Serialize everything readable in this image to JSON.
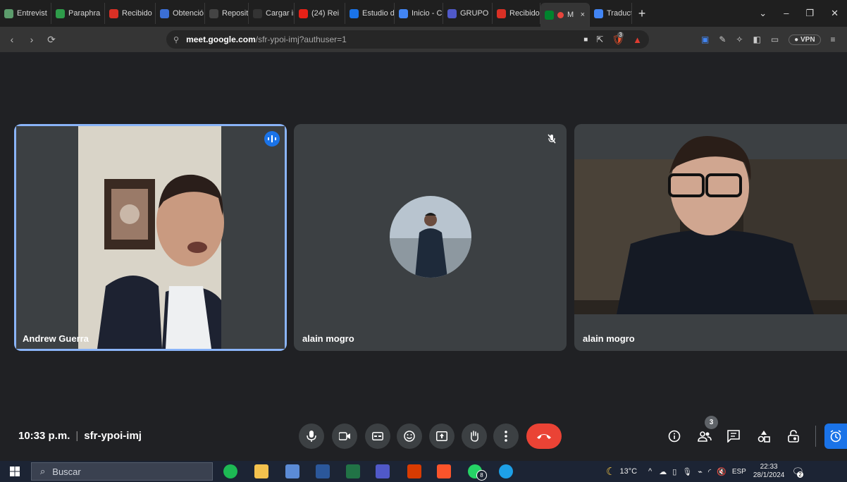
{
  "browser": {
    "tabs": [
      {
        "label": "Entrevist",
        "icon": "green-square-icon",
        "color": "#5c9c6c"
      },
      {
        "label": "Paraphra",
        "icon": "paraphrase-icon",
        "color": "#2e9c4a"
      },
      {
        "label": "Recibido",
        "icon": "gmail-icon",
        "color": "#d93025"
      },
      {
        "label": "Obtenció",
        "icon": "graduation-cap-icon",
        "color": "#3b6fd6"
      },
      {
        "label": "Reposito",
        "icon": "repository-icon",
        "color": "#444444"
      },
      {
        "label": "Cargar in",
        "icon": "c-icon",
        "color": "#333333"
      },
      {
        "label": "(24) Rei",
        "icon": "youtube-icon",
        "color": "#e62117"
      },
      {
        "label": "Estudio d",
        "icon": "s-icon",
        "color": "#1a73e8"
      },
      {
        "label": "Inicio - C",
        "icon": "circle-icon",
        "color": "#4285f4"
      },
      {
        "label": "GRUPO",
        "icon": "teams-icon",
        "color": "#5059c9"
      },
      {
        "label": "Recibido",
        "icon": "gmail-icon",
        "color": "#d93025"
      },
      {
        "label": "M",
        "icon": "meet-icon",
        "color": "#00832d",
        "active": true,
        "close": "×"
      },
      {
        "label": "Traducto",
        "icon": "translate-icon",
        "color": "#4285f4"
      }
    ],
    "new_tab": "+",
    "url_host": "meet.google.com",
    "url_path": "/sfr-ypoi-imj?authuser=1",
    "vpn_label": "VPN",
    "shield_count": "3"
  },
  "meet": {
    "participants": [
      {
        "name": "Andrew Guerra",
        "speaking": true
      },
      {
        "name": "alain mogro",
        "muted": true
      },
      {
        "name": "alain mogro"
      }
    ],
    "time": "10:33 p.m.",
    "separator": "|",
    "meeting_code": "sfr-ypoi-imj",
    "people_count": "3",
    "colors": {
      "accent": "#8ab4f8",
      "end_call": "#ea4335",
      "tile": "#3c4043"
    }
  },
  "taskbar": {
    "search_placeholder": "Buscar",
    "whatsapp_badge": "8",
    "temperature": "13°C",
    "language": "ESP",
    "clock_time": "22:33",
    "clock_date": "28/1/2024",
    "notification_count": "2"
  }
}
